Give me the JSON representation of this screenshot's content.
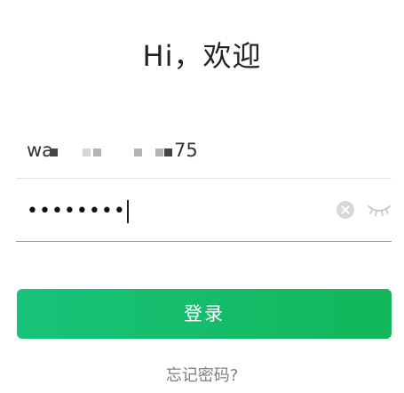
{
  "header": {
    "title": "Hi，欢迎"
  },
  "form": {
    "username": {
      "prefix": "wa",
      "suffix": "75"
    },
    "password": {
      "value": "••••••••"
    },
    "login_label": "登录",
    "forgot_label": "忘记密码?"
  },
  "icons": {
    "clear": "clear-icon",
    "eye": "eye-closed-icon"
  },
  "colors": {
    "accent": "#12b75a",
    "focus_underline": "#7a9cc2"
  }
}
